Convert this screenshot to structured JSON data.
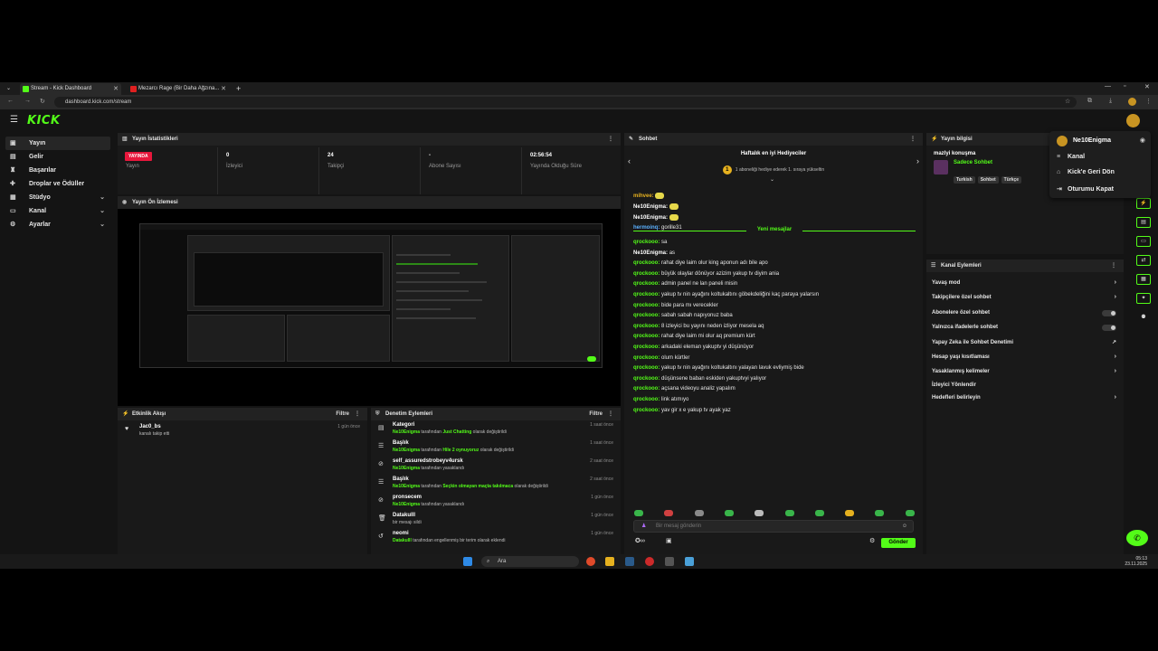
{
  "browser": {
    "tabs": [
      {
        "label": "Stream - Kick Dashboard",
        "fav_color": "#53fc18"
      },
      {
        "label": "Mezarcı Rage (Bir Daha Ağzına...",
        "fav_color": "#e02020"
      }
    ],
    "new_tab": "+",
    "url": "dashboard.kick.com/stream"
  },
  "app": {
    "logo": "KICK",
    "sidebar": [
      {
        "label": "Yayın",
        "icon": "broadcast-icon"
      },
      {
        "label": "Gelir",
        "icon": "money-icon"
      },
      {
        "label": "Başarılar",
        "icon": "trophy-icon"
      },
      {
        "label": "Droplar ve Ödüller",
        "icon": "gift-icon"
      },
      {
        "label": "Stüdyo",
        "icon": "studio-icon"
      },
      {
        "label": "Kanal",
        "icon": "channel-icon"
      },
      {
        "label": "Ayarlar",
        "icon": "gear-icon"
      }
    ],
    "stats": {
      "title": "Yayın İstatistikleri",
      "live_badge": "YAYINDA",
      "items": [
        {
          "value": "",
          "label": "Yayın"
        },
        {
          "value": "0",
          "label": "İzleyici"
        },
        {
          "value": "24",
          "label": "Takipçi"
        },
        {
          "value": "-",
          "label": "Abone Sayısı"
        },
        {
          "value": "02:56:54",
          "label": "Yayında Olduğu Süre"
        }
      ]
    },
    "preview": {
      "title": "Yayın Ön İzlemesi"
    },
    "activity": {
      "title": "Etkinlik Akışı",
      "filter": "Filtre",
      "items": [
        {
          "name": "Jac0_bs",
          "desc": "kanalı takip etti",
          "time": "1 gün önce"
        }
      ]
    },
    "moderation": {
      "title": "Denetim Eylemleri",
      "filter": "Filtre",
      "items": [
        {
          "title": "Kategori",
          "user": "Ne10Enigma",
          "mid": "tarafından",
          "hl": "Just Chatting",
          "tail": "olarak değiştirildi",
          "time": "1 saat önce"
        },
        {
          "title": "Başlık",
          "user": "Ne10Enigma",
          "mid": "tarafından",
          "hl": "Hile 2 oynuyoruz",
          "tail": "olarak değiştirildi",
          "time": "1 saat önce"
        },
        {
          "title": "self_assuredstrobeyv4ursk",
          "user": "Ne10Enigma",
          "mid": "tarafından yasaklandı",
          "hl": "",
          "tail": "",
          "time": "2 saat önce"
        },
        {
          "title": "Başlık",
          "user": "Ne10Enigma",
          "mid": "tarafından",
          "hl": "Seçkin olmayan maçta takılmaca",
          "tail": "olarak değiştirildi",
          "time": "2 saat önce"
        },
        {
          "title": "pronsecem",
          "user": "Ne10Enigma",
          "mid": "tarafından yasaklandı",
          "hl": "",
          "tail": "",
          "time": "1 gün önce"
        },
        {
          "title": "Datakulll",
          "user": "",
          "mid": "bir mesajı sildi",
          "hl": "",
          "tail": "",
          "time": "1 gün önce"
        },
        {
          "title": "neomi",
          "user": "Datakulll",
          "mid": "tarafından engellenmiş bir terim olarak eklendi",
          "hl": "",
          "tail": "",
          "time": "1 gün önce"
        }
      ]
    },
    "chat": {
      "title": "Sohbet",
      "gift_title": "Haftalık en iyi Hediyeciler",
      "gift_badge": "1",
      "gift_sub": "1 aboneliği hediye ederek 1. sıraya yükseltin",
      "early": [
        {
          "user": "mihvee:",
          "color": "#e6b11f",
          "text": ""
        },
        {
          "user": "Ne10Enigma:",
          "color": "#ffffff",
          "text": ""
        },
        {
          "user": "Ne10Enigma:",
          "color": "#ffffff",
          "text": ""
        },
        {
          "user": "hermoinq:",
          "color": "#5ab0ff",
          "text": "gorille31"
        }
      ],
      "new_label": "Yeni mesajlar",
      "messages": [
        {
          "user": "qrockooo:",
          "color": "#53fc18",
          "text": "sa"
        },
        {
          "user": "Ne10Enigma:",
          "color": "#ffffff",
          "text": "as"
        },
        {
          "user": "qrockooo:",
          "color": "#53fc18",
          "text": "rahat diye laim olur king aponun adı bile apo"
        },
        {
          "user": "qrockooo:",
          "color": "#53fc18",
          "text": "büyük olaylar dönüyor azizim yakup tv diyim ania"
        },
        {
          "user": "qrockooo:",
          "color": "#53fc18",
          "text": "admin panel ne lan paneli misin"
        },
        {
          "user": "qrockooo:",
          "color": "#53fc18",
          "text": "yakup tv nin ayağını koltukaltını göbekdeliğini kaç paraya yalarsın"
        },
        {
          "user": "qrockooo:",
          "color": "#53fc18",
          "text": "bide para mı verecekler"
        },
        {
          "user": "qrockooo:",
          "color": "#53fc18",
          "text": "sabah sabah napıyonuz baba"
        },
        {
          "user": "qrockooo:",
          "color": "#53fc18",
          "text": "8 izleyici bu yayını neden izliyor mesela aq"
        },
        {
          "user": "qrockooo:",
          "color": "#53fc18",
          "text": "rahat diye laim mi olur aq premium kürt"
        },
        {
          "user": "qrockooo:",
          "color": "#53fc18",
          "text": "arkadaki eleman yakuptv yi düşünüyor"
        },
        {
          "user": "qrockooo:",
          "color": "#53fc18",
          "text": "olum kürtler"
        },
        {
          "user": "qrockooo:",
          "color": "#53fc18",
          "text": "yakup tv nin ayağını koltukaltını yalayan lavuk evliymiş bide"
        },
        {
          "user": "qrockooo:",
          "color": "#53fc18",
          "text": "düşünsene baban eskiden yakuptvyi yalıyor"
        },
        {
          "user": "qrockooo:",
          "color": "#53fc18",
          "text": "açsana videoyu analiz yapalım"
        },
        {
          "user": "qrockooo:",
          "color": "#53fc18",
          "text": "link atımıyo"
        },
        {
          "user": "qrockooo:",
          "color": "#53fc18",
          "text": "yav gir x e yakup tv ayak yaz"
        }
      ],
      "placeholder": "Bir mesaj gönderin",
      "send": "Gönder"
    },
    "stream_info": {
      "title": "Yayın bilgisi",
      "stream_title": "mazlyi konuşma",
      "category": "Sadece Sohbet",
      "tags": [
        "Turkish",
        "Sohbet",
        "Türkçe"
      ]
    },
    "channel_actions": {
      "title": "Kanal Eylemleri",
      "items": [
        {
          "label": "Yavaş mod",
          "ctl": "chevron"
        },
        {
          "label": "Takipçilere özel sohbet",
          "ctl": "chevron"
        },
        {
          "label": "Abonelere özel sohbet",
          "ctl": "toggle"
        },
        {
          "label": "Yalnızca ifadelerle sohbet",
          "ctl": "toggle"
        },
        {
          "label": "Yapay Zeka ile Sohbet Denetimi",
          "ctl": "icon"
        },
        {
          "label": "Hesap yaşı kısıtlaması",
          "ctl": "chevron"
        },
        {
          "label": "Yasaklanmış kelimeler",
          "ctl": "chevron"
        },
        {
          "label": "İzleyici Yönlendir",
          "ctl": "none"
        },
        {
          "label": "Hedefleri belirleyin",
          "ctl": "chevron"
        }
      ]
    },
    "user_menu": {
      "username": "Ne10Enigma",
      "items": [
        {
          "label": "Kanal",
          "icon": "channel-icon"
        },
        {
          "label": "Kick'e Geri Dön",
          "icon": "kick-icon"
        },
        {
          "label": "Oturumu Kapat",
          "icon": "logout-icon"
        }
      ]
    }
  },
  "taskbar": {
    "search_placeholder": "Ara",
    "time": "05:13",
    "date": "23.11.2025"
  },
  "colors": {
    "accent": "#53fc18",
    "live": "#e8173c"
  }
}
